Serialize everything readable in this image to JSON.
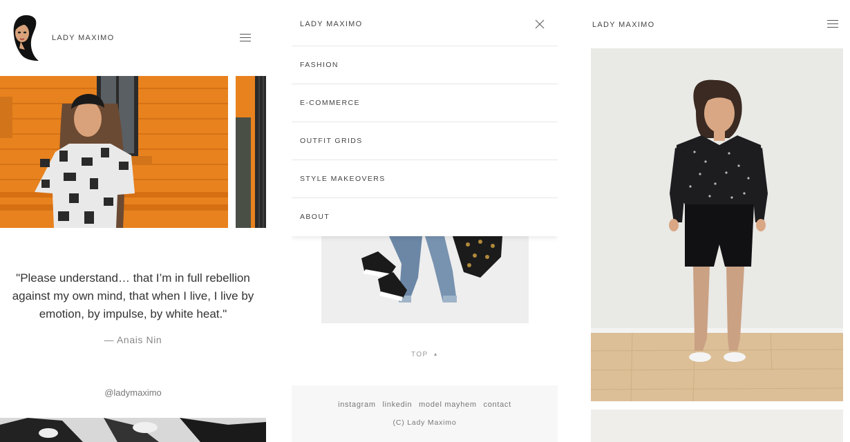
{
  "brand": "LADY MAXIMO",
  "quote": {
    "text": "\"Please understand… that I’m in full rebellion against my own mind, that when I live, I live by emotion, by impulse, by white heat.\"",
    "author": "— Anais Nin"
  },
  "social_handle": "@ladymaximo",
  "menu": {
    "items": [
      "FASHION",
      "E-COMMERCE",
      "OUTFIT GRIDS",
      "STYLE MAKEOVERS",
      "ABOUT"
    ]
  },
  "top_link": "TOP",
  "footer": {
    "links": [
      "instagram",
      "linkedin",
      "model mayhem",
      "contact"
    ],
    "copyright": "(C) Lady Maximo"
  },
  "colors": {
    "orange_wall": "#e8821e",
    "menu_divider": "#e6e6e6",
    "footer_bg": "#f7f7f7"
  }
}
